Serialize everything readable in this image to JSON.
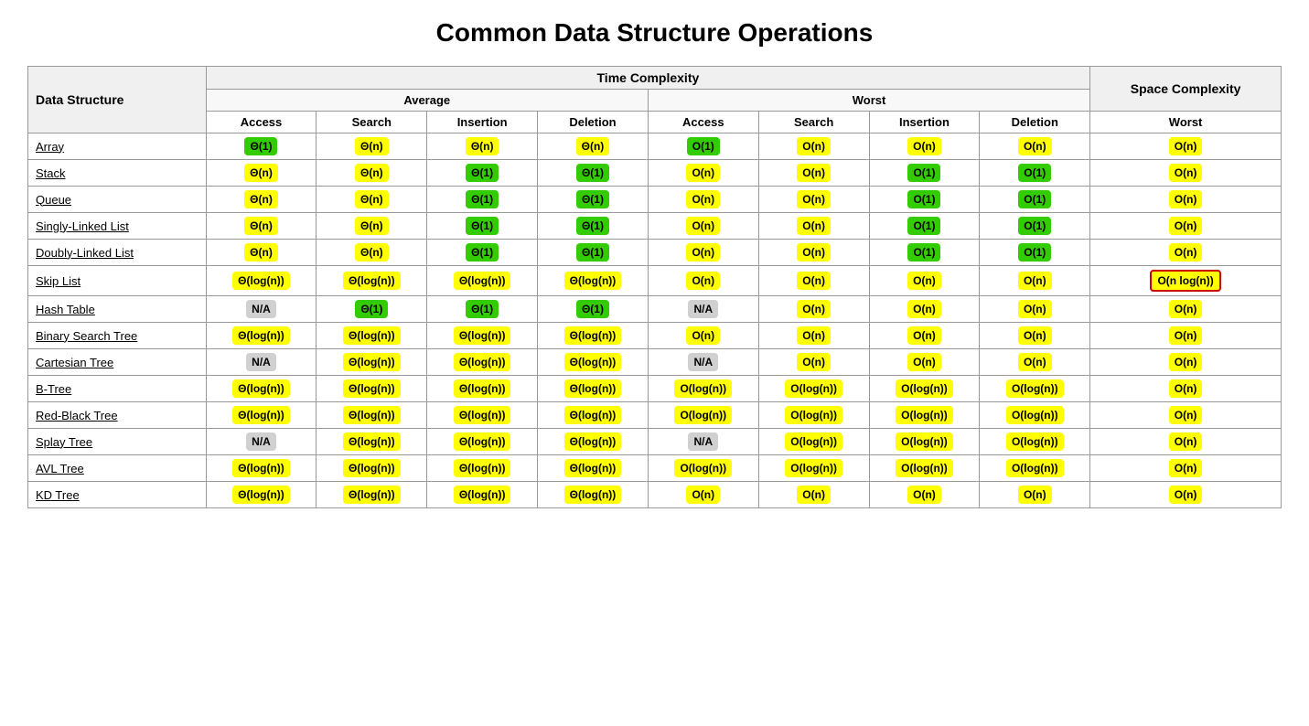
{
  "title": "Common Data Structure Operations",
  "table": {
    "headers": {
      "col1": "Data Structure",
      "time": "Time Complexity",
      "space": "Space Complexity",
      "average": "Average",
      "worst_time": "Worst",
      "worst_space": "Worst",
      "ops": [
        "Access",
        "Search",
        "Insertion",
        "Deletion"
      ]
    },
    "rows": [
      {
        "name": "Array",
        "href": "#",
        "avg": [
          {
            "text": "Θ(1)",
            "color": "green"
          },
          {
            "text": "Θ(n)",
            "color": "yellow"
          },
          {
            "text": "Θ(n)",
            "color": "yellow"
          },
          {
            "text": "Θ(n)",
            "color": "yellow"
          }
        ],
        "worst": [
          {
            "text": "O(1)",
            "color": "green"
          },
          {
            "text": "O(n)",
            "color": "yellow"
          },
          {
            "text": "O(n)",
            "color": "yellow"
          },
          {
            "text": "O(n)",
            "color": "yellow"
          }
        ],
        "space": {
          "text": "O(n)",
          "color": "yellow"
        }
      },
      {
        "name": "Stack",
        "href": "#",
        "avg": [
          {
            "text": "Θ(n)",
            "color": "yellow"
          },
          {
            "text": "Θ(n)",
            "color": "yellow"
          },
          {
            "text": "Θ(1)",
            "color": "green"
          },
          {
            "text": "Θ(1)",
            "color": "green"
          }
        ],
        "worst": [
          {
            "text": "O(n)",
            "color": "yellow"
          },
          {
            "text": "O(n)",
            "color": "yellow"
          },
          {
            "text": "O(1)",
            "color": "green"
          },
          {
            "text": "O(1)",
            "color": "green"
          }
        ],
        "space": {
          "text": "O(n)",
          "color": "yellow"
        }
      },
      {
        "name": "Queue",
        "href": "#",
        "avg": [
          {
            "text": "Θ(n)",
            "color": "yellow"
          },
          {
            "text": "Θ(n)",
            "color": "yellow"
          },
          {
            "text": "Θ(1)",
            "color": "green"
          },
          {
            "text": "Θ(1)",
            "color": "green"
          }
        ],
        "worst": [
          {
            "text": "O(n)",
            "color": "yellow"
          },
          {
            "text": "O(n)",
            "color": "yellow"
          },
          {
            "text": "O(1)",
            "color": "green"
          },
          {
            "text": "O(1)",
            "color": "green"
          }
        ],
        "space": {
          "text": "O(n)",
          "color": "yellow"
        }
      },
      {
        "name": "Singly-Linked List",
        "href": "#",
        "avg": [
          {
            "text": "Θ(n)",
            "color": "yellow"
          },
          {
            "text": "Θ(n)",
            "color": "yellow"
          },
          {
            "text": "Θ(1)",
            "color": "green"
          },
          {
            "text": "Θ(1)",
            "color": "green"
          }
        ],
        "worst": [
          {
            "text": "O(n)",
            "color": "yellow"
          },
          {
            "text": "O(n)",
            "color": "yellow"
          },
          {
            "text": "O(1)",
            "color": "green"
          },
          {
            "text": "O(1)",
            "color": "green"
          }
        ],
        "space": {
          "text": "O(n)",
          "color": "yellow"
        }
      },
      {
        "name": "Doubly-Linked List",
        "href": "#",
        "avg": [
          {
            "text": "Θ(n)",
            "color": "yellow"
          },
          {
            "text": "Θ(n)",
            "color": "yellow"
          },
          {
            "text": "Θ(1)",
            "color": "green"
          },
          {
            "text": "Θ(1)",
            "color": "green"
          }
        ],
        "worst": [
          {
            "text": "O(n)",
            "color": "yellow"
          },
          {
            "text": "O(n)",
            "color": "yellow"
          },
          {
            "text": "O(1)",
            "color": "green"
          },
          {
            "text": "O(1)",
            "color": "green"
          }
        ],
        "space": {
          "text": "O(n)",
          "color": "yellow"
        }
      },
      {
        "name": "Skip List",
        "href": "#",
        "avg": [
          {
            "text": "Θ(log(n))",
            "color": "yellow"
          },
          {
            "text": "Θ(log(n))",
            "color": "yellow"
          },
          {
            "text": "Θ(log(n))",
            "color": "yellow"
          },
          {
            "text": "Θ(log(n))",
            "color": "yellow"
          }
        ],
        "worst": [
          {
            "text": "O(n)",
            "color": "yellow"
          },
          {
            "text": "O(n)",
            "color": "yellow"
          },
          {
            "text": "O(n)",
            "color": "yellow"
          },
          {
            "text": "O(n)",
            "color": "yellow"
          }
        ],
        "space": {
          "text": "O(n log(n))",
          "color": "red-outline"
        }
      },
      {
        "name": "Hash Table",
        "href": "#",
        "avg": [
          {
            "text": "N/A",
            "color": "gray"
          },
          {
            "text": "Θ(1)",
            "color": "green"
          },
          {
            "text": "Θ(1)",
            "color": "green"
          },
          {
            "text": "Θ(1)",
            "color": "green"
          }
        ],
        "worst": [
          {
            "text": "N/A",
            "color": "gray"
          },
          {
            "text": "O(n)",
            "color": "yellow"
          },
          {
            "text": "O(n)",
            "color": "yellow"
          },
          {
            "text": "O(n)",
            "color": "yellow"
          }
        ],
        "space": {
          "text": "O(n)",
          "color": "yellow"
        }
      },
      {
        "name": "Binary Search Tree",
        "href": "#",
        "avg": [
          {
            "text": "Θ(log(n))",
            "color": "yellow"
          },
          {
            "text": "Θ(log(n))",
            "color": "yellow"
          },
          {
            "text": "Θ(log(n))",
            "color": "yellow"
          },
          {
            "text": "Θ(log(n))",
            "color": "yellow"
          }
        ],
        "worst": [
          {
            "text": "O(n)",
            "color": "yellow"
          },
          {
            "text": "O(n)",
            "color": "yellow"
          },
          {
            "text": "O(n)",
            "color": "yellow"
          },
          {
            "text": "O(n)",
            "color": "yellow"
          }
        ],
        "space": {
          "text": "O(n)",
          "color": "yellow"
        }
      },
      {
        "name": "Cartesian Tree",
        "href": "#",
        "avg": [
          {
            "text": "N/A",
            "color": "gray"
          },
          {
            "text": "Θ(log(n))",
            "color": "yellow"
          },
          {
            "text": "Θ(log(n))",
            "color": "yellow"
          },
          {
            "text": "Θ(log(n))",
            "color": "yellow"
          }
        ],
        "worst": [
          {
            "text": "N/A",
            "color": "gray"
          },
          {
            "text": "O(n)",
            "color": "yellow"
          },
          {
            "text": "O(n)",
            "color": "yellow"
          },
          {
            "text": "O(n)",
            "color": "yellow"
          }
        ],
        "space": {
          "text": "O(n)",
          "color": "yellow"
        }
      },
      {
        "name": "B-Tree",
        "href": "#",
        "avg": [
          {
            "text": "Θ(log(n))",
            "color": "yellow"
          },
          {
            "text": "Θ(log(n))",
            "color": "yellow"
          },
          {
            "text": "Θ(log(n))",
            "color": "yellow"
          },
          {
            "text": "Θ(log(n))",
            "color": "yellow"
          }
        ],
        "worst": [
          {
            "text": "O(log(n))",
            "color": "yellow"
          },
          {
            "text": "O(log(n))",
            "color": "yellow"
          },
          {
            "text": "O(log(n))",
            "color": "yellow"
          },
          {
            "text": "O(log(n))",
            "color": "yellow"
          }
        ],
        "space": {
          "text": "O(n)",
          "color": "yellow"
        }
      },
      {
        "name": "Red-Black Tree",
        "href": "#",
        "avg": [
          {
            "text": "Θ(log(n))",
            "color": "yellow"
          },
          {
            "text": "Θ(log(n))",
            "color": "yellow"
          },
          {
            "text": "Θ(log(n))",
            "color": "yellow"
          },
          {
            "text": "Θ(log(n))",
            "color": "yellow"
          }
        ],
        "worst": [
          {
            "text": "O(log(n))",
            "color": "yellow"
          },
          {
            "text": "O(log(n))",
            "color": "yellow"
          },
          {
            "text": "O(log(n))",
            "color": "yellow"
          },
          {
            "text": "O(log(n))",
            "color": "yellow"
          }
        ],
        "space": {
          "text": "O(n)",
          "color": "yellow"
        }
      },
      {
        "name": "Splay Tree",
        "href": "#",
        "avg": [
          {
            "text": "N/A",
            "color": "gray"
          },
          {
            "text": "Θ(log(n))",
            "color": "yellow"
          },
          {
            "text": "Θ(log(n))",
            "color": "yellow"
          },
          {
            "text": "Θ(log(n))",
            "color": "yellow"
          }
        ],
        "worst": [
          {
            "text": "N/A",
            "color": "gray"
          },
          {
            "text": "O(log(n))",
            "color": "yellow"
          },
          {
            "text": "O(log(n))",
            "color": "yellow"
          },
          {
            "text": "O(log(n))",
            "color": "yellow"
          }
        ],
        "space": {
          "text": "O(n)",
          "color": "yellow"
        }
      },
      {
        "name": "AVL Tree",
        "href": "#",
        "avg": [
          {
            "text": "Θ(log(n))",
            "color": "yellow"
          },
          {
            "text": "Θ(log(n))",
            "color": "yellow"
          },
          {
            "text": "Θ(log(n))",
            "color": "yellow"
          },
          {
            "text": "Θ(log(n))",
            "color": "yellow"
          }
        ],
        "worst": [
          {
            "text": "O(log(n))",
            "color": "yellow"
          },
          {
            "text": "O(log(n))",
            "color": "yellow"
          },
          {
            "text": "O(log(n))",
            "color": "yellow"
          },
          {
            "text": "O(log(n))",
            "color": "yellow"
          }
        ],
        "space": {
          "text": "O(n)",
          "color": "yellow"
        }
      },
      {
        "name": "KD Tree",
        "href": "#",
        "avg": [
          {
            "text": "Θ(log(n))",
            "color": "yellow"
          },
          {
            "text": "Θ(log(n))",
            "color": "yellow"
          },
          {
            "text": "Θ(log(n))",
            "color": "yellow"
          },
          {
            "text": "Θ(log(n))",
            "color": "yellow"
          }
        ],
        "worst": [
          {
            "text": "O(n)",
            "color": "yellow"
          },
          {
            "text": "O(n)",
            "color": "yellow"
          },
          {
            "text": "O(n)",
            "color": "yellow"
          },
          {
            "text": "O(n)",
            "color": "yellow"
          }
        ],
        "space": {
          "text": "O(n)",
          "color": "yellow"
        }
      }
    ]
  }
}
